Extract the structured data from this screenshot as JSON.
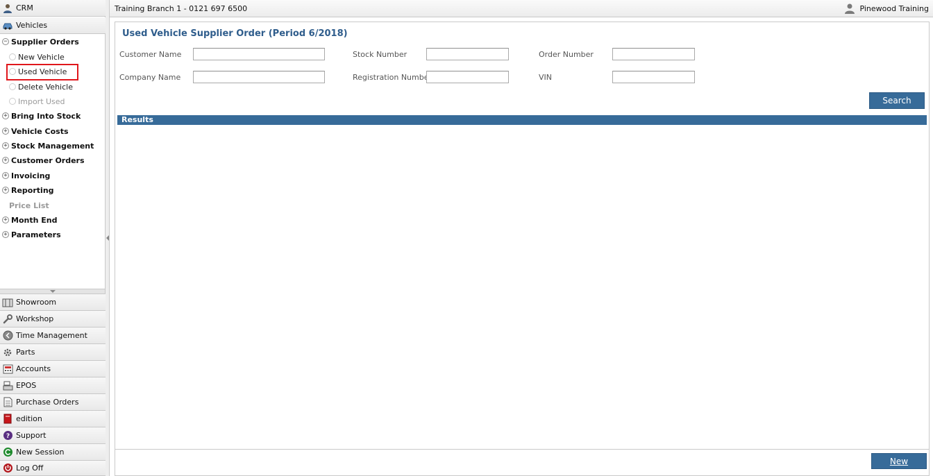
{
  "sidebar": {
    "top_modules": [
      {
        "label": "CRM",
        "icon": "user-icon"
      },
      {
        "label": "Vehicles",
        "icon": "car-icon"
      }
    ],
    "tree": {
      "supplier_orders": {
        "label": "Supplier Orders",
        "children": [
          "New Vehicle",
          "Used Vehicle",
          "Delete Vehicle",
          "Import Used"
        ]
      },
      "nodes": [
        "Bring Into Stock",
        "Vehicle Costs",
        "Stock Management",
        "Customer Orders",
        "Invoicing",
        "Reporting",
        "Price List",
        "Month End",
        "Parameters"
      ]
    },
    "bottom_modules": [
      "Showroom",
      "Workshop",
      "Time Management",
      "Parts",
      "Accounts",
      "EPOS",
      "Purchase Orders",
      "edition",
      "Support",
      "New Session",
      "Log Off"
    ]
  },
  "header": {
    "branch": "Training Branch 1 - 0121 697 6500",
    "user": "Pinewood Training"
  },
  "main": {
    "title": "Used Vehicle Supplier Order (Period 6/2018)",
    "fields": {
      "customer_name": {
        "label": "Customer Name",
        "value": ""
      },
      "stock_number": {
        "label": "Stock Number",
        "value": ""
      },
      "order_number": {
        "label": "Order Number",
        "value": ""
      },
      "company_name": {
        "label": "Company Name",
        "value": ""
      },
      "registration_number": {
        "label": "Registration Number",
        "value": ""
      },
      "vin": {
        "label": "VIN",
        "value": ""
      }
    },
    "search_label": "Search",
    "results_label": "Results",
    "new_label": "New"
  },
  "colors": {
    "accent": "#376b99",
    "title": "#2f5d8c",
    "highlight": "#e0161b"
  }
}
